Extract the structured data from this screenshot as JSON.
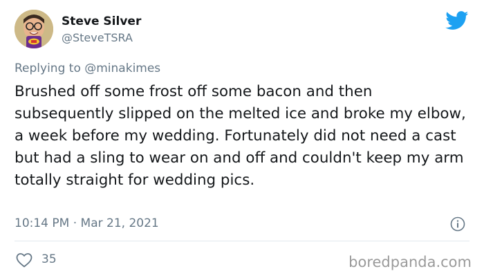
{
  "tweet": {
    "author_name": "Steve Silver",
    "author_handle": "@SteveTSRA",
    "replying_prefix": "Replying to ",
    "replying_to": "@minakimes",
    "text": "Brushed off some frost off some bacon and then subsequently slipped on the melted ice and broke my elbow, a week before my wedding. Fortunately did not need a cast but had a sling to wear on and off and couldn't keep my arm totally straight for wedding pics.",
    "time": "10:14 PM",
    "separator": " · ",
    "date": "Mar 21, 2021",
    "likes": "35"
  },
  "icons": {
    "brand": "twitter-bird-icon",
    "info": "info-icon",
    "like": "heart-icon"
  },
  "colors": {
    "twitter_blue": "#1da1f2",
    "text": "#14171a",
    "muted": "#657786",
    "divider": "#e1e8ed",
    "watermark": "#9a9a9a"
  },
  "watermark": "boredpanda.com"
}
